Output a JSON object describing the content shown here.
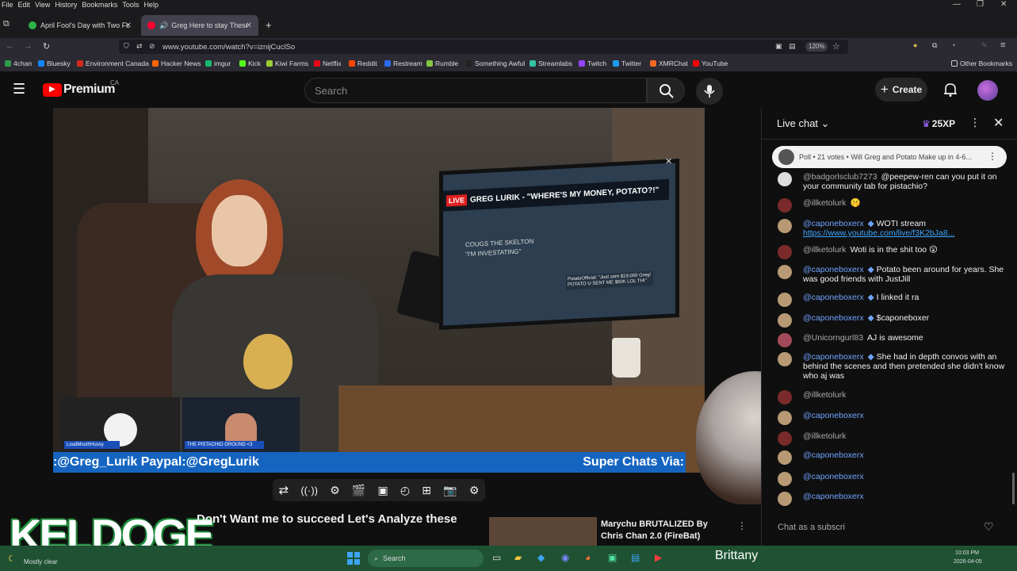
{
  "menubar": [
    "File",
    "Edit",
    "View",
    "History",
    "Bookmarks",
    "Tools",
    "Help"
  ],
  "tabs": [
    {
      "title": "April Fool's Day with Two Fool's",
      "active": false
    },
    {
      "title": "Greg Here to stay These Pe",
      "active": true
    }
  ],
  "url": "www.youtube.com/watch?v=iznijCuclSo",
  "zoom": "120%",
  "bookmarks": [
    "4chan",
    "Bluesky",
    "Environment Canada",
    "Hacker News",
    "imgur",
    "Kick",
    "Kiwi Farms",
    "Netflix",
    "Reddit",
    "Restream",
    "Rumble",
    "Something Awful",
    "Streamlabs",
    "Twitch",
    "Twitter",
    "XMRChat",
    "YouTube"
  ],
  "other_bookmarks": "Other Bookmarks",
  "yt": {
    "logo": "Premium",
    "region": "CA",
    "search_placeholder": "Search",
    "create": "Create"
  },
  "video": {
    "screen_banner": "GREG LURIK - \"WHERE'S MY MONEY, POTATO?!\"",
    "live": "LIVE",
    "screen_sub1": "COUGS THE SKELTON",
    "screen_sub2": "\"I'M INVESTATING\"",
    "screen_note": "PotatoOfficial: \"Just sent $19,000 Greg! POTATO U SENT ME $50K LOL THI\"",
    "guest1": "LoudMouthHussy",
    "guest2": "THE PISTACHIO GROUND <3",
    "ticker_left": ":@Greg_Lurik Paypal:@GregLurik",
    "ticker_right": "Super Chats Via:"
  },
  "below_video": {
    "title": "Don't Want me to succeed Let's Analyze these",
    "rec_title": "Marychu BRUTALIZED By Chris Chan 2.0 (FireBat)",
    "overlay_text": "KELDOGE"
  },
  "chat": {
    "title": "Live chat",
    "xp": "25XP",
    "poll": "Poll • 21 votes • Will Greg and Potato Make up in 4-6...",
    "input_placeholder": "Chat as a subscri",
    "messages": [
      {
        "author": "@badgorlsclub7273",
        "text": "@peepew-ren can you put it on your community tab for pistachio?"
      },
      {
        "author": "@illketolurk",
        "text": "🤫"
      },
      {
        "author": "@caponeboxerx",
        "text": "WOTI stream ",
        "link": "https://www.youtube.com/live/f3K2bJa8..."
      },
      {
        "author": "@illketolurk",
        "text": "Woti is in the shit too 😲"
      },
      {
        "author": "@caponeboxerx",
        "text": "Potato been around for years. She was good friends with JustJill"
      },
      {
        "author": "@caponeboxerx",
        "text": "I linked it ra"
      },
      {
        "author": "@caponeboxerx",
        "text": "$caponeboxer"
      },
      {
        "author": "@Unicorngurl83",
        "text": "AJ is awesome"
      },
      {
        "author": "@caponeboxerx",
        "text": "She had in depth convos with an behind the scenes and then pretended she didn't know who aj was"
      },
      {
        "author": "@illketolurk",
        "text": ""
      },
      {
        "author": "@caponeboxerx",
        "text": ""
      },
      {
        "author": "@illketolurk",
        "text": ""
      },
      {
        "author": "@caponeboxerx",
        "text": ""
      },
      {
        "author": "@caponeboxerx",
        "text": ""
      },
      {
        "author": "@caponeboxerx",
        "text": ""
      }
    ]
  },
  "taskbar": {
    "weather": "Mostly clear",
    "search": "Search",
    "user": "Brittany",
    "time": "10:03 PM",
    "date": "2026-04-05"
  },
  "colors": {
    "accent": "#ff0000",
    "ticker": "#1565c0",
    "taskbar": "#1e5233"
  }
}
